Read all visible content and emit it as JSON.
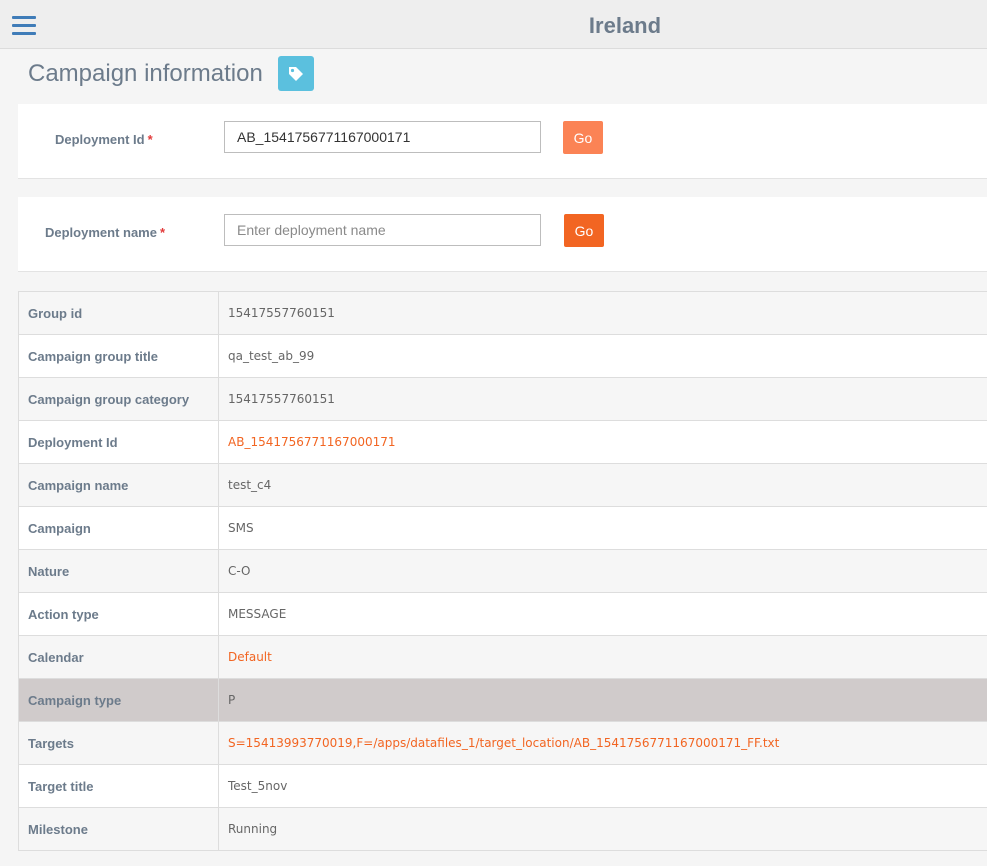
{
  "header": {
    "title": "Ireland",
    "menu_icon": "hamburger-menu-icon"
  },
  "page": {
    "title": "Campaign information",
    "tag_icon": "tag-icon"
  },
  "deployment_id_form": {
    "label": "Deployment Id",
    "required_mark": "*",
    "value": "AB_1541756771167000171",
    "placeholder": "",
    "go_label": "Go"
  },
  "deployment_name_form": {
    "label": "Deployment name",
    "required_mark": "*",
    "value": "",
    "placeholder": "Enter deployment name",
    "go_label": "Go"
  },
  "details": [
    {
      "label": "Group id",
      "value": "15417557760151",
      "link": false
    },
    {
      "label": "Campaign group title",
      "value": "qa_test_ab_99",
      "link": false
    },
    {
      "label": "Campaign group category",
      "value": "15417557760151",
      "link": false
    },
    {
      "label": "Deployment Id",
      "value": "AB_1541756771167000171",
      "link": true
    },
    {
      "label": "Campaign name",
      "value": "test_c4",
      "link": false
    },
    {
      "label": "Campaign",
      "value": "SMS",
      "link": false
    },
    {
      "label": "Nature",
      "value": "C-O",
      "link": false
    },
    {
      "label": "Action type",
      "value": "MESSAGE",
      "link": false
    },
    {
      "label": "Calendar",
      "value": "Default",
      "link": true
    },
    {
      "label": "Campaign type",
      "value": "P",
      "link": false,
      "highlighted": true
    },
    {
      "label": "Targets",
      "value": "S=15413993770019,F=/apps/datafiles_1/target_location/AB_1541756771167000171_FF.txt",
      "link": true
    },
    {
      "label": "Target title",
      "value": "Test_5nov",
      "link": false
    },
    {
      "label": "Milestone",
      "value": "Running",
      "link": false
    }
  ],
  "colors": {
    "accent_orange": "#f26522",
    "tag_button": "#5bc0de",
    "menu_blue": "#3f7cb8",
    "label_gray": "#6c7b8b"
  }
}
